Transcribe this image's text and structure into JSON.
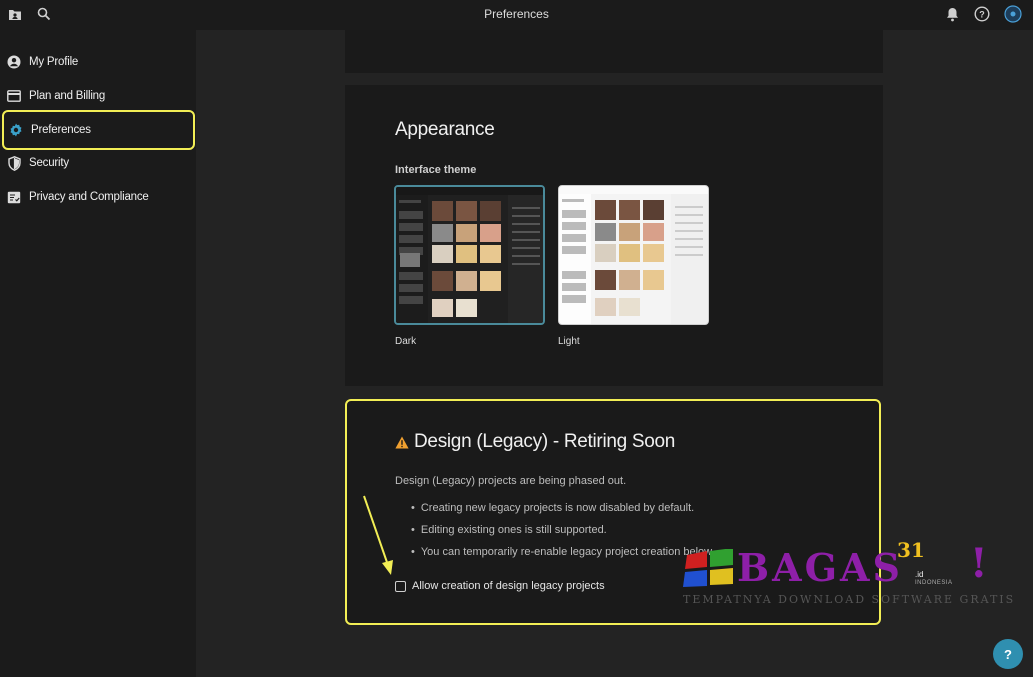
{
  "window": {
    "title": "Preferences"
  },
  "topbar": {
    "icons": [
      "folder-user-icon",
      "search-icon",
      "bell-icon",
      "help-circle-icon",
      "avatar"
    ]
  },
  "sidebar": {
    "items": [
      {
        "label": "My Profile",
        "icon": "user-circle-icon"
      },
      {
        "label": "Plan and Billing",
        "icon": "card-icon"
      },
      {
        "label": "Preferences",
        "icon": "gear-icon",
        "active": true
      },
      {
        "label": "Security",
        "icon": "shield-icon"
      },
      {
        "label": "Privacy and Compliance",
        "icon": "document-check-icon"
      }
    ]
  },
  "appearance": {
    "heading": "Appearance",
    "subheading": "Interface theme",
    "themes": [
      {
        "label": "Dark",
        "selected": true
      },
      {
        "label": "Light",
        "selected": false
      }
    ]
  },
  "legacy": {
    "heading": "Design (Legacy) - Retiring Soon",
    "description": "Design (Legacy) projects are being phased out.",
    "bullets": [
      "Creating new legacy projects is now disabled by default.",
      "Editing existing ones is still supported.",
      "You can temporarily re-enable legacy project creation below."
    ],
    "checkbox_label": "Allow creation of design legacy projects",
    "checkbox_checked": false
  },
  "help_button": {
    "label": "?"
  },
  "watermark": {
    "brand": "BAGAS",
    "number": "31",
    "domain": ".id",
    "country": "INDONESIA",
    "excl": "!",
    "tagline": "TEMPATNYA DOWNLOAD SOFTWARE GRATIS"
  },
  "colors": {
    "highlight": "#f2ee55",
    "accent": "#2f8fb0",
    "warning": "#f0a030",
    "watermark": "#8e1fa8"
  }
}
